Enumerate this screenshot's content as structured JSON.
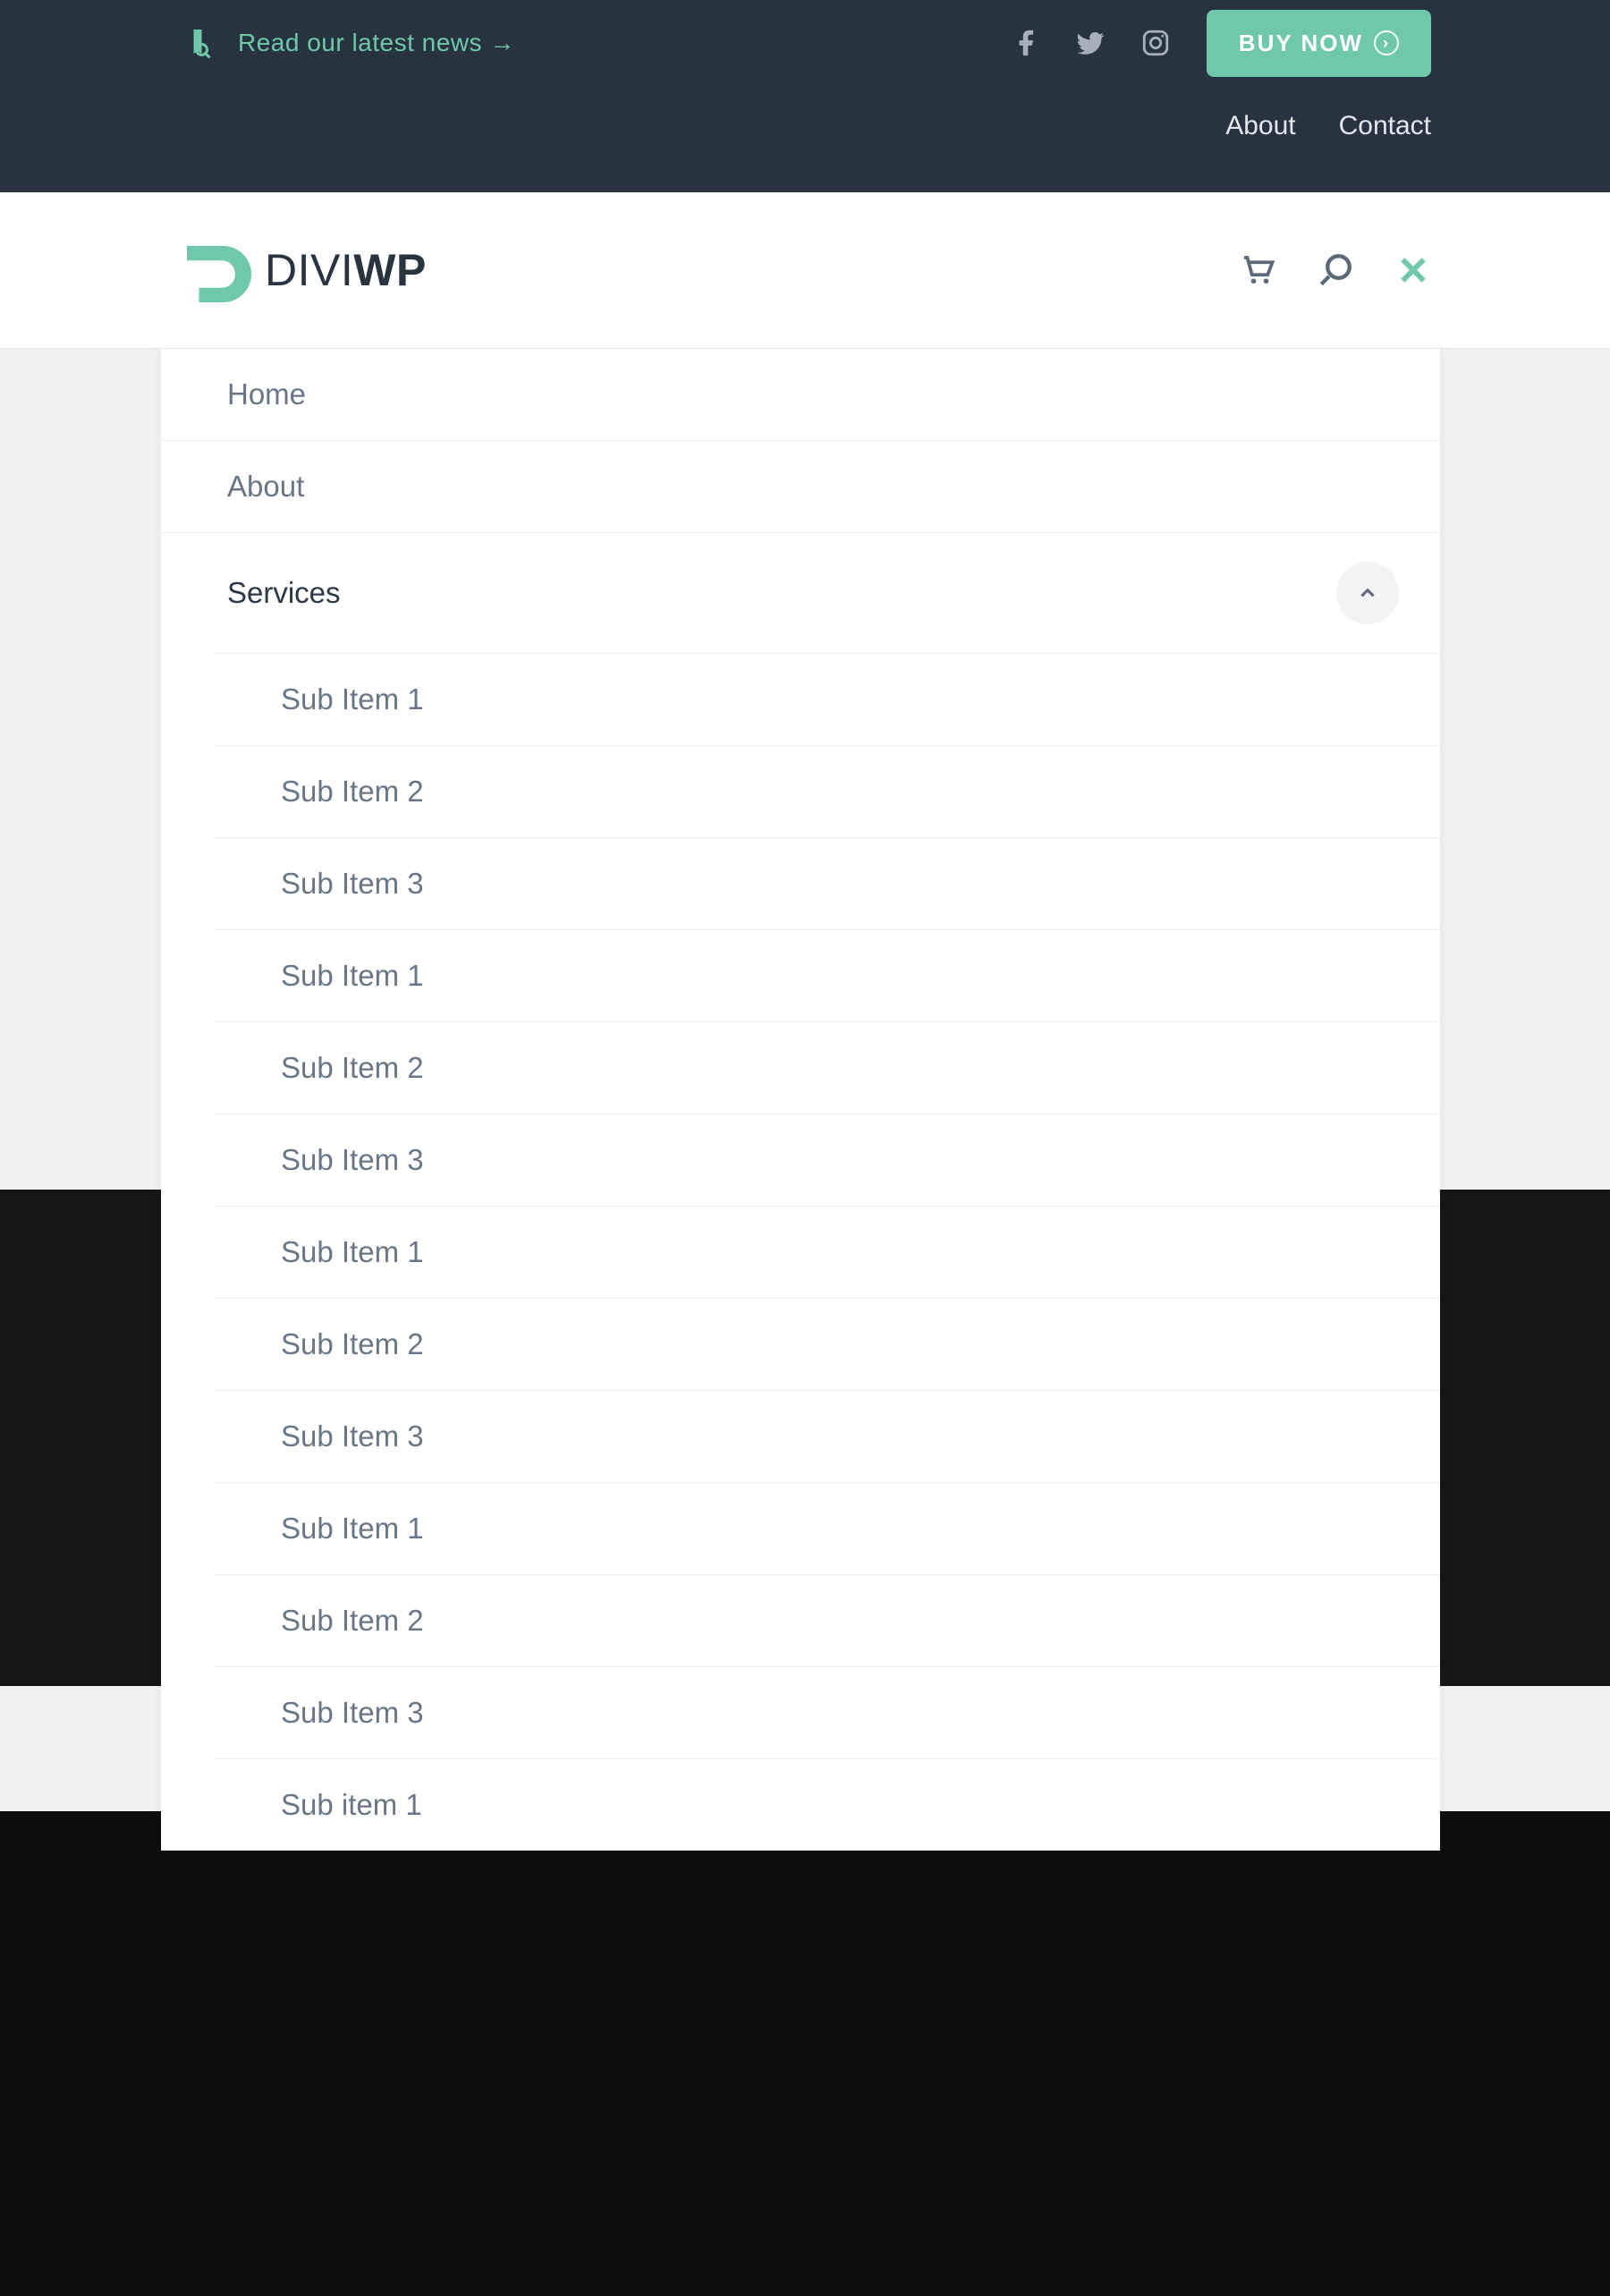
{
  "topbar": {
    "news_text": "Read our latest news →",
    "buy_label": "BUY NOW",
    "links": [
      "About",
      "Contact"
    ]
  },
  "logo": {
    "thin": "DIVI",
    "bold": "WP"
  },
  "menu": {
    "items": [
      {
        "label": "Home",
        "active": false
      },
      {
        "label": "About",
        "active": false
      },
      {
        "label": "Services",
        "active": true,
        "expanded": true
      }
    ],
    "sub_items": [
      "Sub Item 1",
      "Sub Item 2",
      "Sub Item 3",
      "Sub Item 1",
      "Sub Item 2",
      "Sub Item 3",
      "Sub Item 1",
      "Sub Item 2",
      "Sub Item 3",
      "Sub Item 1",
      "Sub Item 2",
      "Sub Item 3",
      "Sub item 1"
    ]
  },
  "colors": {
    "accent": "#6fc9a8",
    "darkbar": "#273341",
    "text_muted": "#6a7685",
    "text_dark": "#2d3844"
  }
}
